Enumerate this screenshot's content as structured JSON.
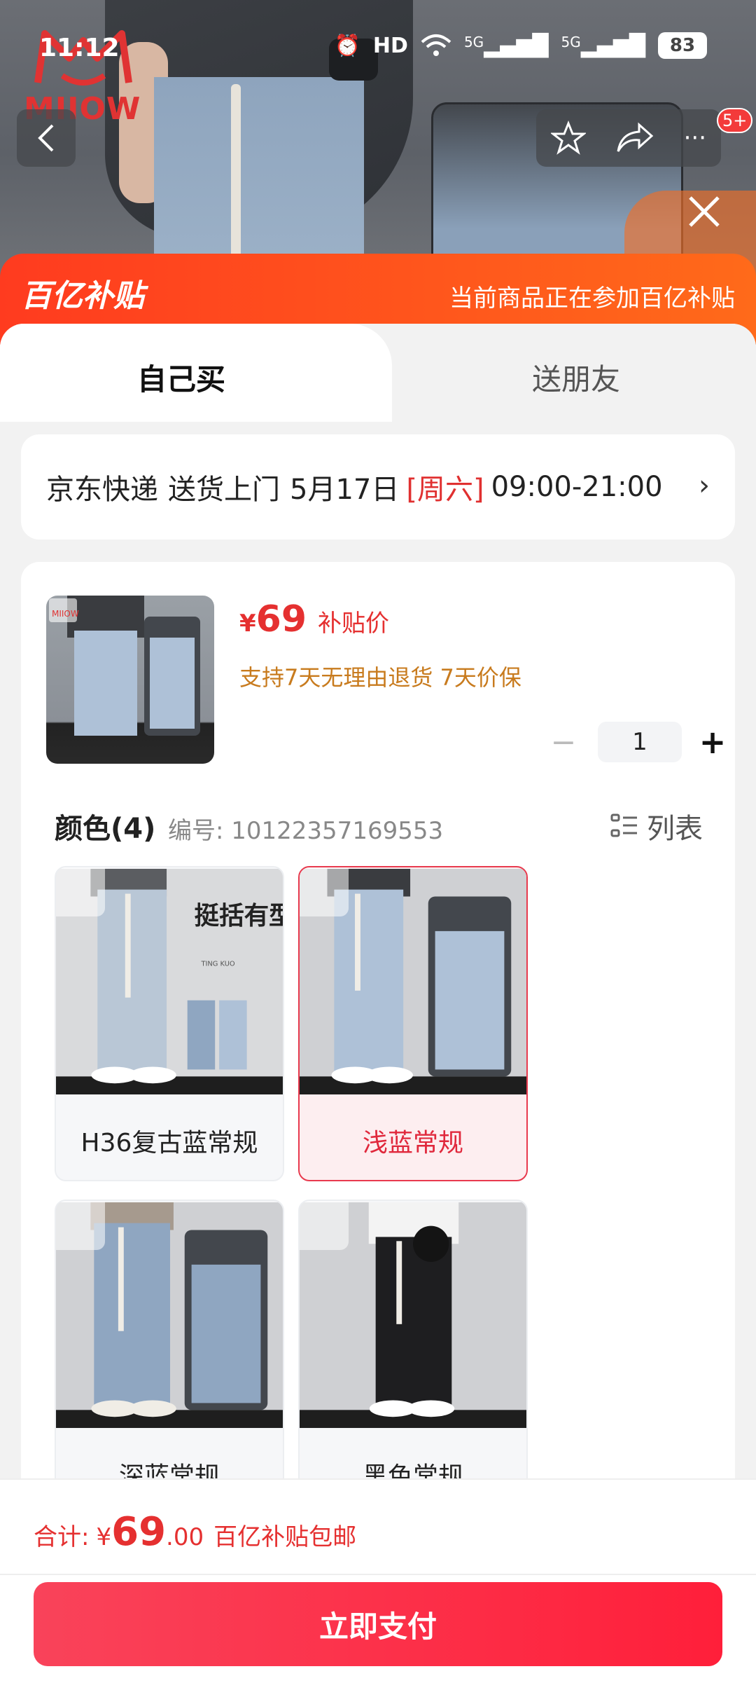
{
  "status_bar": {
    "time": "11:12",
    "network_hd": "HD",
    "net1": "5G",
    "net2": "5G",
    "battery": "83"
  },
  "brand": {
    "logo_text": "MIIOW"
  },
  "top_nav": {
    "notification_count": "5+"
  },
  "banner": {
    "brand": "百亿补贴",
    "notice": "当前商品正在参加百亿补贴"
  },
  "tabs": [
    {
      "label": "自己买"
    },
    {
      "label": "送朋友"
    }
  ],
  "delivery": {
    "carrier": "京东快递",
    "method": "送货上门",
    "date": "5月17日",
    "weekday": "[周六]",
    "window": "09:00-21:00"
  },
  "product": {
    "currency": "¥",
    "price": "69",
    "price_tag": "补贴价",
    "guarantee": "支持7天无理由退货  7天价保",
    "quantity": "1"
  },
  "colors": {
    "heading": "颜色(4)",
    "sku_label": "编号: 10122357169553",
    "list_label": "列表",
    "options": [
      {
        "label": "H36复古蓝常规",
        "selected": false,
        "tone": "#b9c7d6"
      },
      {
        "label": "浅蓝常规",
        "selected": true,
        "tone": "#aec1d7"
      },
      {
        "label": "深蓝常规",
        "selected": false,
        "tone": "#8fa6c1"
      },
      {
        "label": "黑色常规",
        "selected": false,
        "tone": "#1e1e20"
      }
    ],
    "promo_text_1": "挺括有型",
    "promo_text_2": "TING KUO"
  },
  "footer": {
    "total_label": "合计:",
    "currency": "¥",
    "total_int": "69",
    "total_dec": ".00",
    "shipping": "百亿补贴包邮",
    "pay_button": "立即支付"
  },
  "accent_colors": {
    "subsidy": "#ff4a1c",
    "price": "#e53030",
    "pay": "#ff1f3a"
  }
}
